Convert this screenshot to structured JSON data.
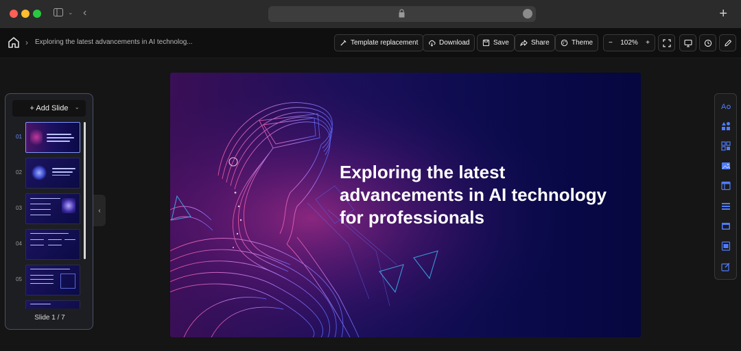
{
  "browser": {
    "icons": [
      "sidebar-toggle-icon",
      "chevron-down-icon",
      "back-arrow-icon",
      "lock-icon",
      "more-icon",
      "new-tab-icon"
    ]
  },
  "toolbar": {
    "doc_title": "Exploring the latest advancements in AI technolog...",
    "template_replacement": "Template replacement",
    "download": "Download",
    "save": "Save",
    "share": "Share",
    "theme": "Theme",
    "zoom_minus": "−",
    "zoom_value": "102%",
    "zoom_plus": "+"
  },
  "sidebar": {
    "add_slide": "+ Add Slide",
    "slides": [
      {
        "num": "01",
        "active": true
      },
      {
        "num": "02",
        "active": false
      },
      {
        "num": "03",
        "active": false
      },
      {
        "num": "04",
        "active": false
      },
      {
        "num": "05",
        "active": false
      }
    ],
    "slide_count": "Slide 1 / 7",
    "collapse_icon": "chevron-left-icon"
  },
  "slide": {
    "title": "Exploring the latest advancements in AI technology for professionals"
  },
  "right_toolbar": {
    "icons": [
      "text-style-icon",
      "shapes-icon",
      "qr-icon",
      "image-icon",
      "layout-icon",
      "list-icon",
      "window-icon",
      "table-icon",
      "edit-box-icon"
    ]
  },
  "colors": {
    "accent": "#6c8cff",
    "slide_bg_left": "#3a0f57",
    "slide_bg_right": "#060640",
    "icon_blue": "#4f7cff"
  }
}
